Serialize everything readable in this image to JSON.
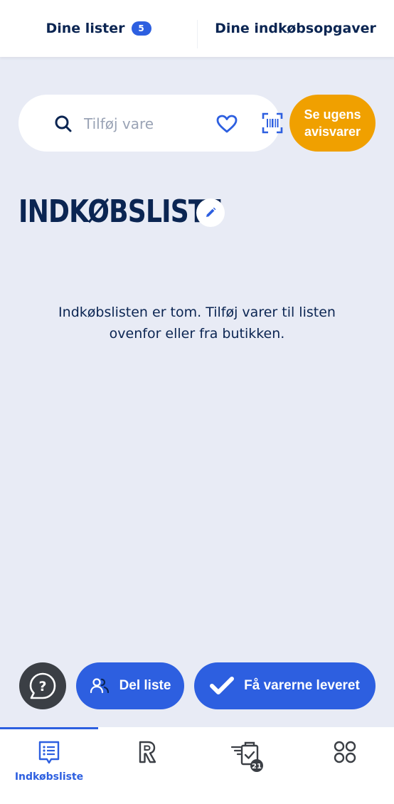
{
  "top_tabs": {
    "lists_label": "Dine lister",
    "lists_count": "5",
    "tasks_label": "Dine indkøbsopgaver"
  },
  "search": {
    "placeholder": "Tilføj vare"
  },
  "deals_button": {
    "line1": "Se ugens",
    "line2": "avisvarer"
  },
  "page": {
    "title": "INDKØBSLISTE",
    "empty_line1": "Indkøbslisten er tom. Tilføj varer til listen",
    "empty_line2": "ovenfor eller fra butikken."
  },
  "actions": {
    "share_label": "Del liste",
    "delivery_label": "Få varerne leveret"
  },
  "bottom_nav": {
    "shopping_list_label": "Indkøbsliste",
    "tasks_badge": "21"
  },
  "colors": {
    "accent": "#2d5fe0",
    "deals": "#f0a000",
    "background": "#e8ebf5",
    "text": "#0b2552"
  },
  "icons": [
    "search-icon",
    "heart-icon",
    "barcode-scan-icon",
    "pencil-icon",
    "help-chat-icon",
    "people-icon",
    "checkmark-icon",
    "list-icon",
    "rema-r-icon",
    "tasks-icon",
    "apps-grid-icon"
  ]
}
